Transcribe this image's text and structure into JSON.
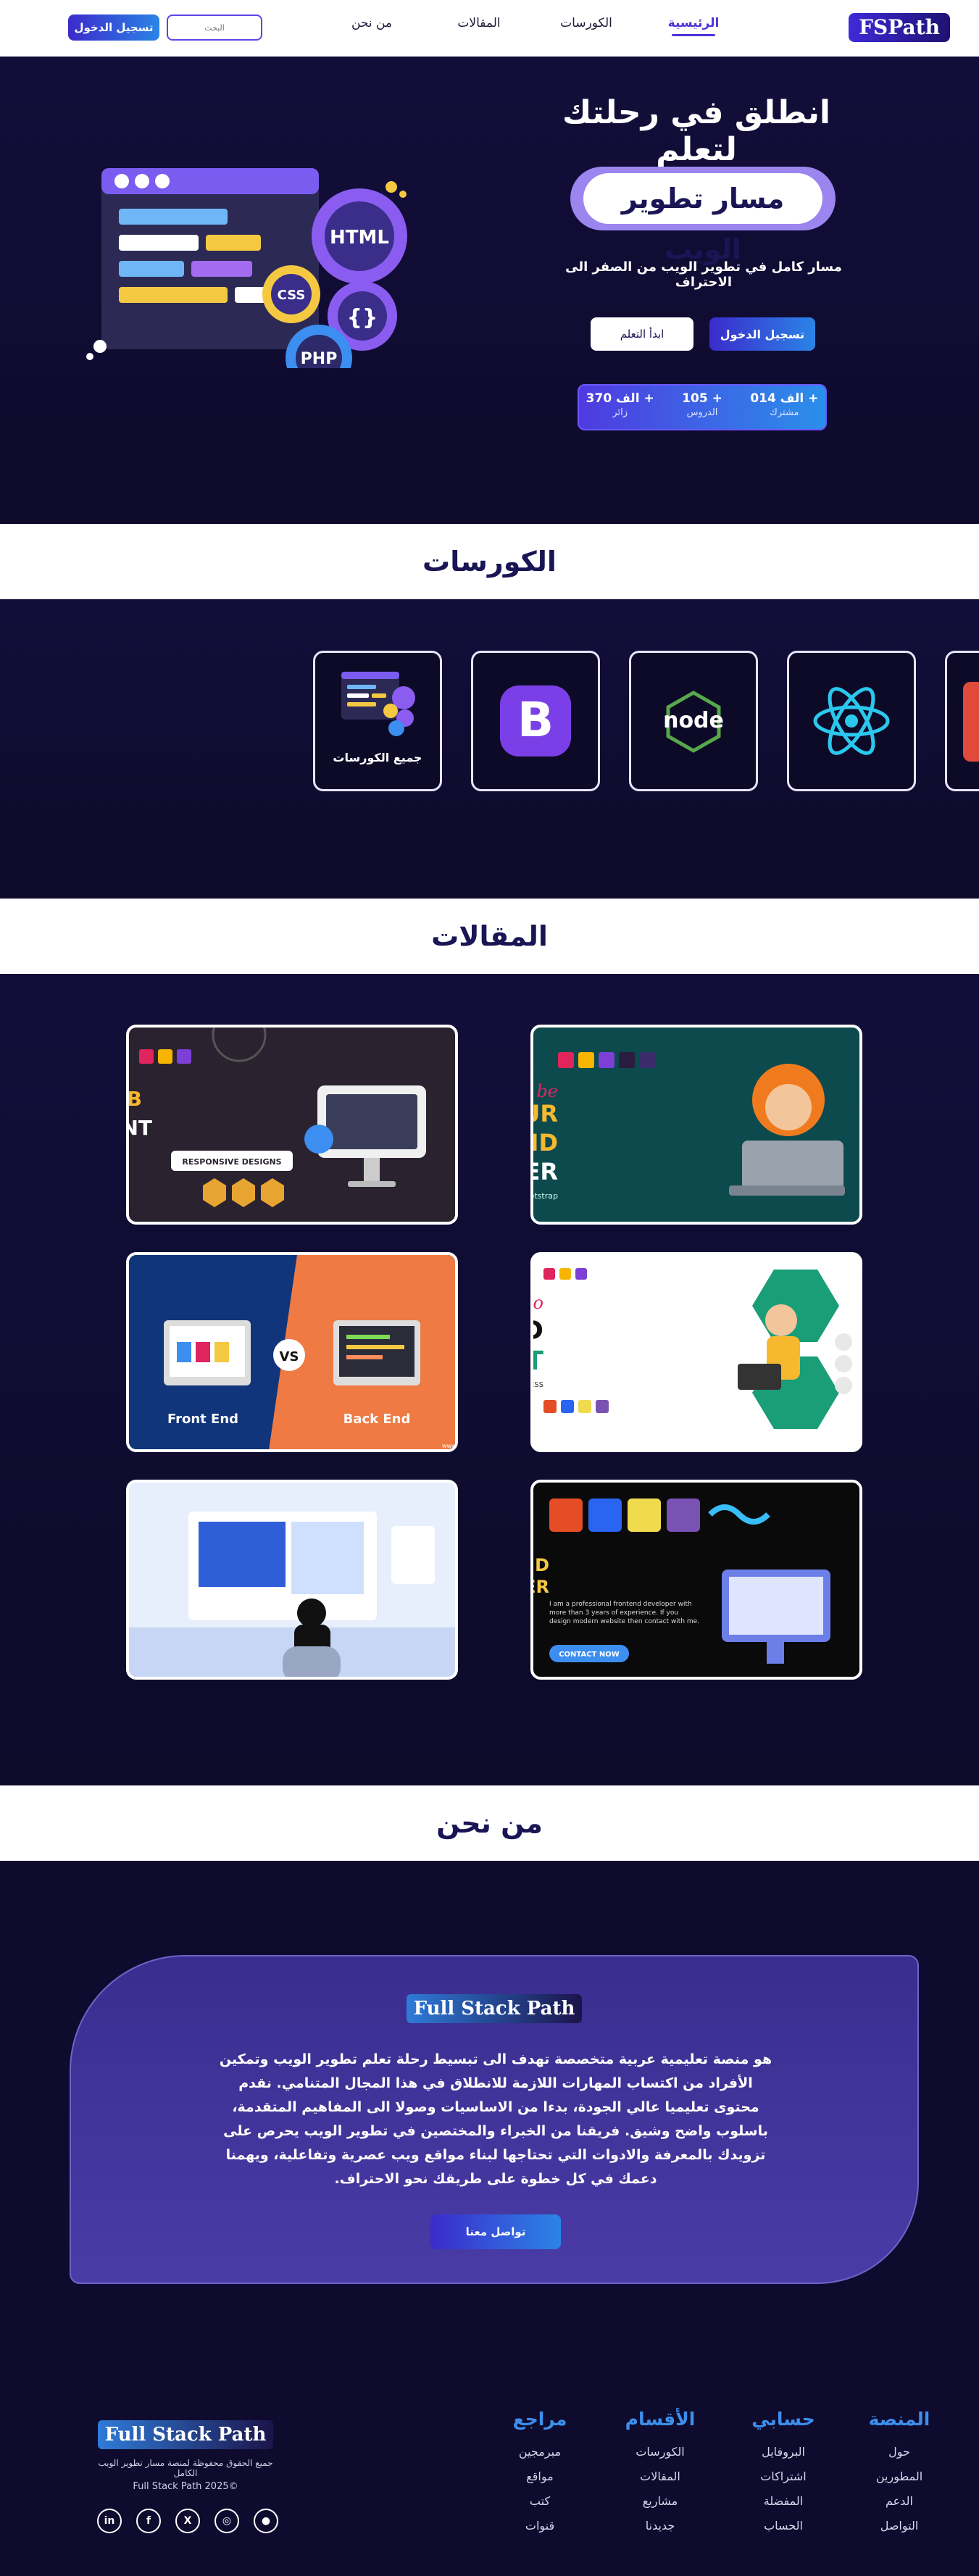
{
  "nav": {
    "brand": "FSPath",
    "links": [
      "الرئيسية",
      "الكورسات",
      "المقالات",
      "من نحن"
    ],
    "search_placeholder": "البحث",
    "login": "تسجيل الدخول"
  },
  "hero": {
    "title": "انطلق في رحلتك لتعلم",
    "pill": "مسار تطوير الويب",
    "subtitle": "مسار كامل في تطوير الويب من الصفر الى الاحتراف",
    "login_button": "تسجيل الدخول",
    "start_button": "ابدأ التعلم",
    "art_labels": [
      "HTML",
      "CSS",
      "{}",
      "PHP"
    ],
    "stats": [
      {
        "value": "014 الف +",
        "label": "مشترك"
      },
      {
        "value": "105 +",
        "label": "الدروس"
      },
      {
        "value": "370 الف +",
        "label": "زائر"
      }
    ]
  },
  "courses": {
    "heading": "الكورسات",
    "all_courses_label": "جميع الكورسات",
    "icons": [
      "bootstrap-icon",
      "nodejs-icon",
      "react-icon"
    ],
    "bootstrap_glyph": "B",
    "node_glyph": "node"
  },
  "articles": {
    "heading": "المقالات",
    "cards": [
      {
        "name": "front-end-developer-card",
        "line1": "I'll be",
        "line2": "YOUR",
        "line3": "FRONT-END",
        "line4": "DEVELOPER",
        "sub": "HTML - CSS - JavaScript - Bootstrap"
      },
      {
        "name": "front-end-web-development-card",
        "line1": "FRONT-END WEB",
        "line2": "DEVELOPMENT",
        "badge": "RESPONSIVE DESIGNS"
      },
      {
        "name": "front-end-development-card",
        "line1": "I'll do",
        "line2": "FRONT-END",
        "line3": "DEVELOPMENT",
        "sub": "HTML - CSS - JavaScript - Bootstrap - TailwindCSS"
      },
      {
        "name": "frontend-vs-backend-card",
        "left": "Front End",
        "right": "Back End",
        "vs": "VS",
        "foot": "www.yourwebsite.com"
      },
      {
        "name": "front-end-web-developer-card",
        "line1": "FRONT -END",
        "line2": "WEB DEVELOPER",
        "body": "I am a professional frontend developer with more than 3 years of experience. If you design modern website then contact with me.",
        "cta": "CONTACT NOW"
      },
      {
        "name": "workspace-illustration-card"
      }
    ]
  },
  "about": {
    "heading": "من نحن",
    "brand": "Full Stack Path",
    "text": "هو منصة تعليمية عربية متخصصة تهدف الى تبسيط رحلة تعلم تطوير الويب وتمكين الأفراد من اكتساب المهارات اللازمة للانطلاق في هذا المجال المتنامي. نقدم محتوى تعليميا عالي الجودة، بدءا من الاساسيات وصولا الى المفاهيم المتقدمة، باسلوب واضح وشيق. فريقنا من الخبراء والمختصين في تطوير الويب يحرص على تزويدك بالمعرفة والادوات التي تحتاجها لبناء مواقع ويب عصرية وتفاعلية، ويهمنا دعمك في كل خطوة على طريقك نحو الاحتراف.",
    "button": "تواصل معنا"
  },
  "footer": {
    "columns": [
      {
        "title": "المنصة",
        "links": [
          "حول",
          "المطورين",
          "الدعم",
          "التواصل"
        ]
      },
      {
        "title": "حسابي",
        "links": [
          "البروفايل",
          "اشتراكات",
          "المفضلة",
          "الحساب"
        ]
      },
      {
        "title": "الأقسام",
        "links": [
          "الكورسات",
          "المقالات",
          "مشاريع",
          "جديدنا"
        ]
      },
      {
        "title": "مراجع",
        "links": [
          "مبرمجين",
          "مواقع",
          "كتب",
          "قنوات"
        ]
      }
    ],
    "brand": "Full Stack Path",
    "copyright": "جميع الحقوق محفوظة لمنصة مسار تطوير الويب الكامل",
    "year": "Full Stack Path 2025©",
    "socials": [
      "in",
      "f",
      "X",
      "◎",
      "●"
    ]
  }
}
